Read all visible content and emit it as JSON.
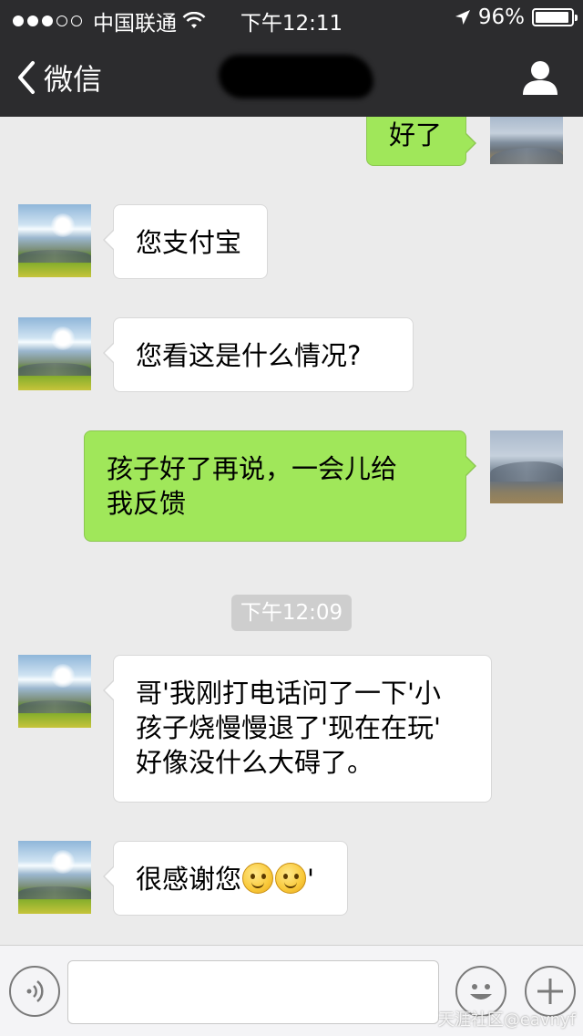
{
  "status_bar": {
    "carrier": "中国联通",
    "time": "下午12:11",
    "battery": "96%",
    "battery_level": 0.96
  },
  "nav": {
    "back_label": "微信",
    "title": ""
  },
  "messages": [
    {
      "side": "out",
      "text": "好了"
    },
    {
      "side": "in",
      "text": "您支付宝"
    },
    {
      "side": "in",
      "text": "您看这是什么情况?"
    },
    {
      "side": "out",
      "lines": [
        "孩子好了再说，一会儿给",
        "我反馈"
      ]
    },
    {
      "side": "in",
      "lines": [
        "哥'我刚打电话问了一下'小",
        "孩子烧慢慢退了'现在在玩'",
        "好像没什么大碍了。"
      ]
    },
    {
      "side": "in",
      "text_before": "很感谢您",
      "text_after": "'"
    }
  ],
  "timestamp": "下午12:09",
  "input": {
    "placeholder": ""
  },
  "watermark": "天涯社区@eavnyf",
  "colors": {
    "bar_dark": "#2c2c2e",
    "chat_bg": "#ebebeb",
    "bubble_out": "#a0e75a",
    "bubble_in": "#ffffff",
    "timestamp_bg": "#cecece"
  },
  "icons": [
    "signal-dots-icon",
    "wifi-icon",
    "location-arrow-icon",
    "battery-icon",
    "back-chevron-icon",
    "profile-icon",
    "voice-icon",
    "emoji-icon",
    "plus-icon",
    "smiley-emoji-icon"
  ]
}
